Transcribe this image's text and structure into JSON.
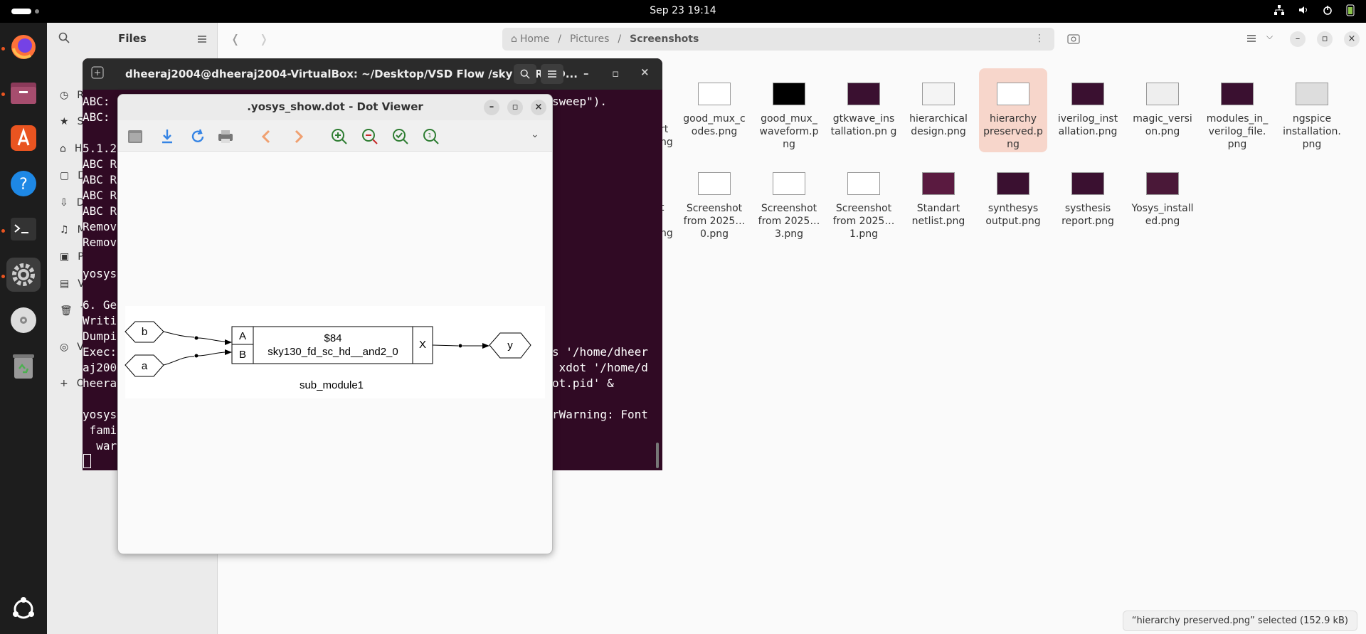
{
  "topbar": {
    "clock": "Sep 23  19:14"
  },
  "files": {
    "sidebar": {
      "title": "Files",
      "items": [
        {
          "label": "R",
          "icon": "clock-icon"
        },
        {
          "label": "S",
          "icon": "star-icon"
        },
        {
          "label": "H",
          "icon": "home-icon"
        },
        {
          "label": "D",
          "icon": "document-icon"
        },
        {
          "label": "D",
          "icon": "download-icon"
        },
        {
          "label": "M",
          "icon": "music-icon"
        },
        {
          "label": "P",
          "icon": "picture-icon"
        },
        {
          "label": "V",
          "icon": "video-icon"
        },
        {
          "label": "T",
          "icon": "trash-icon"
        },
        {
          "label": "V",
          "icon": "disc-icon"
        },
        {
          "label": "O",
          "icon": "plus-icon"
        }
      ]
    },
    "breadcrumb": {
      "home": "Home",
      "pictures": "Pictures",
      "current": "Screenshots"
    },
    "grid": {
      "row1": [
        {
          "name": "good_mux_c odes.png"
        },
        {
          "name": "good_mux_ waveform.p ng"
        },
        {
          "name": "gtkwave_ins tallation.pn g"
        },
        {
          "name": "hierarchical design.png"
        },
        {
          "name": "hierarchy preserved.p ng",
          "selected": true
        },
        {
          "name": "iverilog_inst allation.png"
        },
        {
          "name": "magic_versi on.png"
        },
        {
          "name": "modules_in_ verilog_file. png"
        },
        {
          "name": "ngspice installation. png"
        }
      ],
      "row2": [
        {
          "name": "Screenshot from 2025…0.png"
        },
        {
          "name": "Screenshot from 2025…3.png"
        },
        {
          "name": "Screenshot from 2025…1.png"
        },
        {
          "name": "Standart netlist.png"
        },
        {
          "name": "synthesys output.png"
        },
        {
          "name": "systhesis report.png"
        },
        {
          "name": "Yosys_install ed.png"
        }
      ],
      "clipped_left": [
        "rt",
        "ng",
        "t",
        "ng"
      ]
    },
    "status": "“hierarchy preserved.png” selected  (152.9 kB)"
  },
  "terminal": {
    "title": "dheeraj2004@dheeraj2004-VirtualBox: ~/Desktop/VSD Flow /sky130RTLD...",
    "lines_left": [
      "ABC:",
      "ABC:",
      "",
      "5.1.2",
      "ABC R",
      "ABC R",
      "ABC R",
      "ABC R",
      "Remov",
      "Remov",
      "",
      "yosys",
      "",
      "6. Ge",
      "Writi",
      "Dumpi",
      "Exec:",
      "aj200",
      "heera",
      "",
      "yosys",
      " fami",
      "  war"
    ],
    "lines_right": [
      {
        "row": 0,
        "text": "sweep\")."
      },
      {
        "row": 16,
        "text": "s '/home/dheer"
      },
      {
        "row": 17,
        "text": " xdot '/home/d"
      },
      {
        "row": 18,
        "text": "ot.pid' &"
      },
      {
        "row": 20,
        "text": "rWarning: Font"
      }
    ]
  },
  "dot_viewer": {
    "title": ".yosys_show.dot - Dot Viewer",
    "graph": {
      "input_b": "b",
      "input_a": "a",
      "port_a": "A",
      "port_b": "B",
      "cell_id": "$84",
      "cell_type": "sky130_fd_sc_hd__and2_0",
      "port_x": "X",
      "output_y": "y",
      "module": "sub_module1"
    }
  }
}
